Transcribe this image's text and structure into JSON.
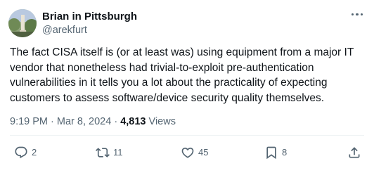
{
  "author": {
    "name": "Brian in Pittsburgh",
    "handle": "@arekfurt"
  },
  "tweet": {
    "text": "The fact CISA itself is (or at least was) using equipment from a major IT\nvendor that nonetheless had trivial-to-exploit pre-authentication\nvulnerabilities in it tells you a lot about the practicality of expecting\ncustomers to assess software/device security quality themselves.",
    "time": "9:19 PM",
    "date": "Mar 8, 2024",
    "separator": "·",
    "views_count": "4,813",
    "views_label": "Views"
  },
  "actions": {
    "replies": "2",
    "reposts": "11",
    "likes": "45",
    "bookmarks": "8"
  },
  "icons": {
    "more": "more-horizontal-icon",
    "reply": "reply-icon",
    "repost": "repost-icon",
    "like": "heart-icon",
    "bookmark": "bookmark-icon",
    "share": "share-icon"
  },
  "colors": {
    "text": "#0f1419",
    "secondary": "#536471",
    "divider": "#eff3f4"
  }
}
